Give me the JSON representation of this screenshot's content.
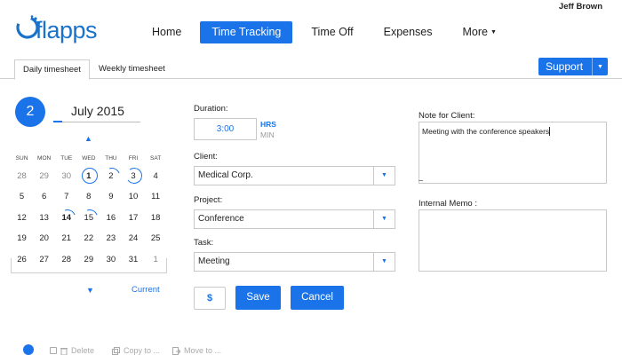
{
  "user": {
    "name": "Jeff Brown"
  },
  "logo": {
    "text": "flapps"
  },
  "nav": {
    "items": [
      "Home",
      "Time Tracking",
      "Time Off",
      "Expenses"
    ],
    "more": "More"
  },
  "tabs": {
    "daily": "Daily timesheet",
    "weekly": "Weekly timesheet"
  },
  "support": {
    "label": "Support"
  },
  "calendar": {
    "day": "2",
    "month": "July 2015",
    "weekdays": [
      "SUN",
      "MON",
      "TUE",
      "WED",
      "THU",
      "FRI",
      "SAT"
    ],
    "weeks": [
      [
        "28",
        "29",
        "30",
        "1",
        "2",
        "3",
        "4"
      ],
      [
        "5",
        "6",
        "7",
        "8",
        "9",
        "10",
        "11"
      ],
      [
        "12",
        "13",
        "14",
        "15",
        "16",
        "17",
        "18"
      ],
      [
        "19",
        "20",
        "21",
        "22",
        "23",
        "24",
        "25"
      ],
      [
        "26",
        "27",
        "28",
        "29",
        "30",
        "31",
        "1"
      ]
    ],
    "current_label": "Current"
  },
  "form": {
    "duration_label": "Duration:",
    "duration_value": "3:00",
    "hrs": "HRS",
    "min": "MIN",
    "client_label": "Client:",
    "client_value": "Medical Corp.",
    "project_label": "Project:",
    "project_value": "Conference",
    "task_label": "Task:",
    "task_value": "Meeting",
    "dollar": "$",
    "save": "Save",
    "cancel": "Cancel"
  },
  "notes": {
    "client_label": "Note for Client:",
    "client_text": "Meeting with the conference speakers",
    "memo_label": "Internal Memo :"
  },
  "footer": {
    "delete": "Delete",
    "copy": "Copy to ...",
    "move": "Move to ..."
  },
  "colors": {
    "accent": "#1a73e8"
  }
}
